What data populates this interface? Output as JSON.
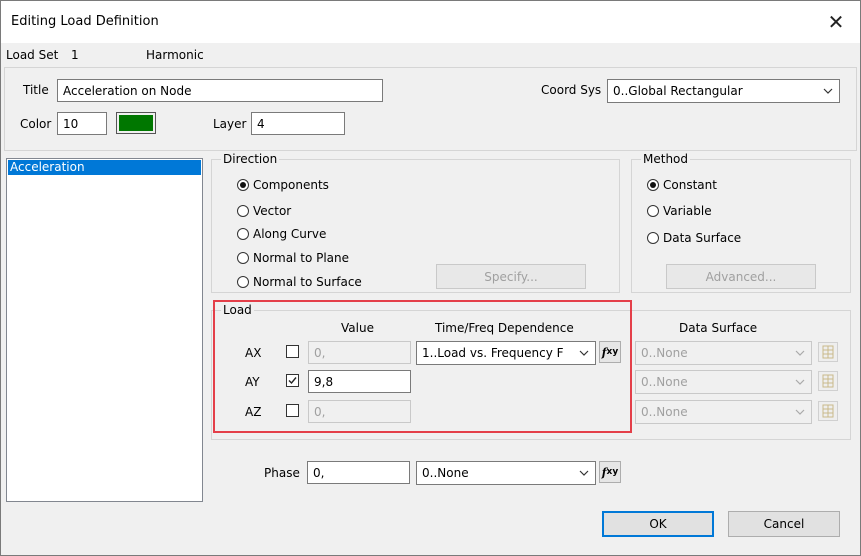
{
  "window": {
    "title": "Editing Load Definition"
  },
  "load_set": {
    "label": "Load Set",
    "id": "1",
    "type": "Harmonic"
  },
  "header": {
    "title_label": "Title",
    "title_value": "Acceleration on Node",
    "coord_sys_label": "Coord Sys",
    "coord_sys_value": "0..Global Rectangular",
    "color_label": "Color",
    "color_value": "10",
    "color_swatch_hex": "#007700",
    "layer_label": "Layer",
    "layer_value": "4"
  },
  "load_types": {
    "items": [
      "Acceleration"
    ],
    "selected": "Acceleration"
  },
  "direction": {
    "label": "Direction",
    "options": [
      "Components",
      "Vector",
      "Along Curve",
      "Normal to Plane",
      "Normal to Surface"
    ],
    "selected": "Components",
    "specify_label": "Specify..."
  },
  "method": {
    "label": "Method",
    "options": [
      "Constant",
      "Variable",
      "Data Surface"
    ],
    "selected": "Constant",
    "advanced_label": "Advanced..."
  },
  "load": {
    "label": "Load",
    "value_header": "Value",
    "dependence_header": "Time/Freq Dependence",
    "data_surface_header": "Data Surface",
    "rows": [
      {
        "name": "AX",
        "checked": false,
        "value": "0,",
        "dependence": "1..Load vs. Frequency F",
        "data_surface": "0..None"
      },
      {
        "name": "AY",
        "checked": true,
        "value": "9,8",
        "dependence": "",
        "data_surface": "0..None"
      },
      {
        "name": "AZ",
        "checked": false,
        "value": "0,",
        "dependence": "",
        "data_surface": "0..None"
      }
    ]
  },
  "phase": {
    "label": "Phase",
    "value": "0,",
    "function": "0..None"
  },
  "buttons": {
    "ok": "OK",
    "cancel": "Cancel"
  },
  "icons": {
    "fxy_glyph": "f",
    "fxy_sub": "xy"
  },
  "colors": {
    "highlight_box": "#e43f49",
    "selection": "#0078d7"
  }
}
